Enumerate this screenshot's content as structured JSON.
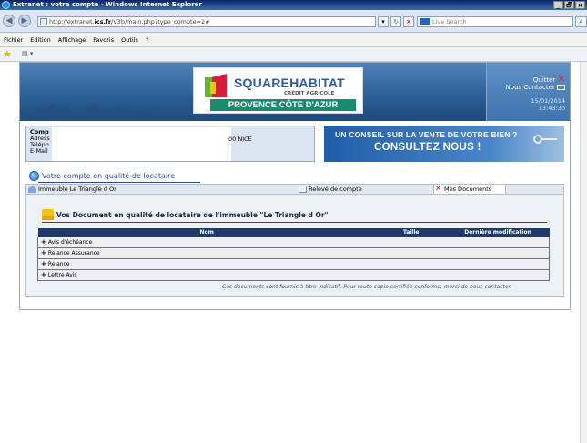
{
  "window": {
    "title": "Extranet : votre compte - Windows Internet Explorer",
    "controls": [
      "_",
      "🗗",
      "×"
    ]
  },
  "address_bar": {
    "url_prefix": "http://extranet.",
    "url_domain": "ics.fr",
    "url_suffix": "/V3b/main.php?type_compte=2#",
    "search_placeholder": "Live Search"
  },
  "menu": {
    "items": [
      "Fichier",
      "Edition",
      "Affichage",
      "Favoris",
      "Outils",
      "?"
    ]
  },
  "banner": {
    "logo_square": "SQUARE",
    "logo_habitat": "HABITAT",
    "logo_sub": "CRÉDIT AGRICOLE",
    "logo_region": "PROVENCE CÔTE D'AZUR",
    "quit_label": "Quitter",
    "contact_label": "Nous Contacter",
    "date": "15/01/2014",
    "time": "13:43:30"
  },
  "info": {
    "labels": [
      "Comp",
      "Adress",
      "Téléph",
      "E-Mail"
    ],
    "city": "00 NICE"
  },
  "promo": {
    "line1": "UN CONSEIL SUR LA VENTE DE VOTRE BIEN ?",
    "line2": "CONSULTEZ NOUS !"
  },
  "section": {
    "title": "Votre compte en qualité de locataire"
  },
  "tabs": {
    "immeuble": "Immeuble Le Triangle d Or",
    "releve": "Relevé de compte",
    "documents": "Mes Documents"
  },
  "documents": {
    "heading": "Vos Document en qualité de locataire de l'immeuble \"Le Triangle d Or\"",
    "columns": [
      "Nom",
      "Taille",
      "Dernière modification"
    ],
    "rows": [
      "Avis d'échéance",
      "Relance Assurance",
      "Relance",
      "Lettre Avis"
    ],
    "disclaimer": "Ces documents sont fournis à titre indicatif. Pour toute copie certifiée conforme, merci de nous contacter."
  }
}
